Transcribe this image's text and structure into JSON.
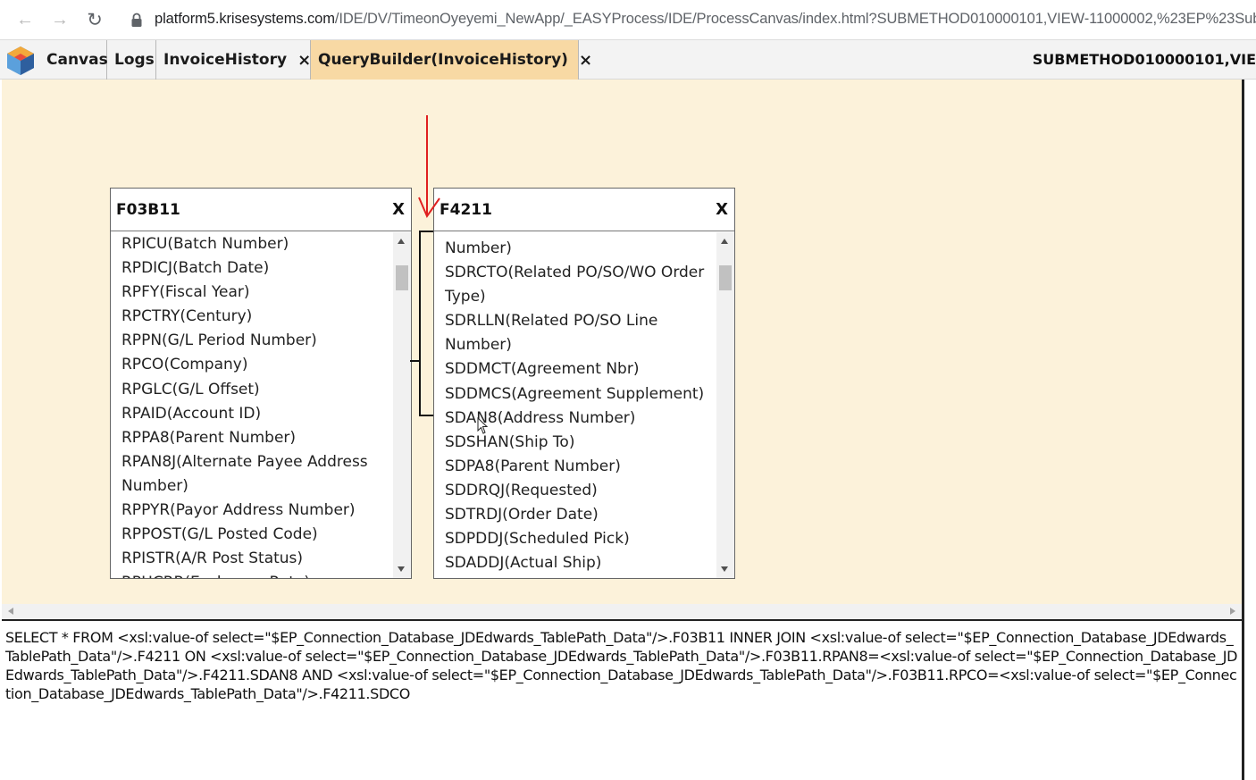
{
  "browser": {
    "url_host": "platform5.krisesystems.com",
    "url_path": "/IDE/DV/TimeonOyeyemi_NewApp/_EASYProcess/IDE/ProcessCanvas/index.html?SUBMETHOD010000101,VIEW-11000002,%23EP%23Sub"
  },
  "tabs": [
    {
      "label": "Canvas"
    },
    {
      "label": "Logs"
    },
    {
      "label": "InvoiceHistory",
      "close": "×"
    },
    {
      "label": "QueryBuilder(InvoiceHistory)",
      "close": "×",
      "active": true
    }
  ],
  "tab_right_label": "SUBMETHOD010000101,VIE",
  "tables": [
    {
      "name": "F03B11",
      "close": "X",
      "fields": [
        "RPICU(Batch Number)",
        "RPDICJ(Batch Date)",
        "RPFY(Fiscal Year)",
        "RPCTRY(Century)",
        "RPPN(G/L Period Number)",
        "RPCO(Company)",
        "RPGLC(G/L Offset)",
        "RPAID(Account ID)",
        "RPPA8(Parent Number)",
        "RPAN8J(Alternate Payee Address\nNumber)",
        "RPPYR(Payor Address Number)",
        "RPPOST(G/L Posted Code)",
        "RPISTR(A/R Post Status)",
        "RPHCRR(Exchange Rate)"
      ]
    },
    {
      "name": "F4211",
      "close": "X",
      "fields": [
        "Number)",
        "SDRCTO(Related PO/SO/WO Order\nType)",
        "SDRLLN(Related PO/SO Line\nNumber)",
        "SDDMCT(Agreement Nbr)",
        "SDDMCS(Agreement Supplement)",
        "SDAN8(Address Number)",
        "SDSHAN(Ship To)",
        "SDPA8(Parent Number)",
        "SDDRQJ(Requested)",
        "SDTRDJ(Order Date)",
        "SDPDDJ(Scheduled Pick)",
        "SDADDJ(Actual Ship)"
      ]
    }
  ],
  "sql_text": "SELECT * FROM <xsl:value-of select=\"$EP_Connection_Database_JDEdwards_TablePath_Data\"/>.F03B11 INNER JOIN <xsl:value-of select=\"$EP_Connection_Database_JDEdwards_TablePath_Data\"/>.F4211 ON <xsl:value-of select=\"$EP_Connection_Database_JDEdwards_TablePath_Data\"/>.F03B11.RPAN8=<xsl:value-of select=\"$EP_Connection_Database_JDEdwards_TablePath_Data\"/>.F4211.SDAN8 AND <xsl:value-of select=\"$EP_Connection_Database_JDEdwards_TablePath_Data\"/>.F03B11.RPCO=<xsl:value-of select=\"$EP_Connection_Database_JDEdwards_TablePath_Data\"/>.F4211.SDCO",
  "colors": {
    "canvas_bg": "#fcf2da",
    "active_tab_bg": "#f8d9a4",
    "annotation_red": "#e02020"
  },
  "icons": [
    "back-arrow-icon",
    "forward-arrow-icon",
    "reload-icon",
    "lock-icon",
    "app-logo-icon",
    "close-icon",
    "scroll-arrow-icon",
    "mouse-cursor-icon"
  ]
}
